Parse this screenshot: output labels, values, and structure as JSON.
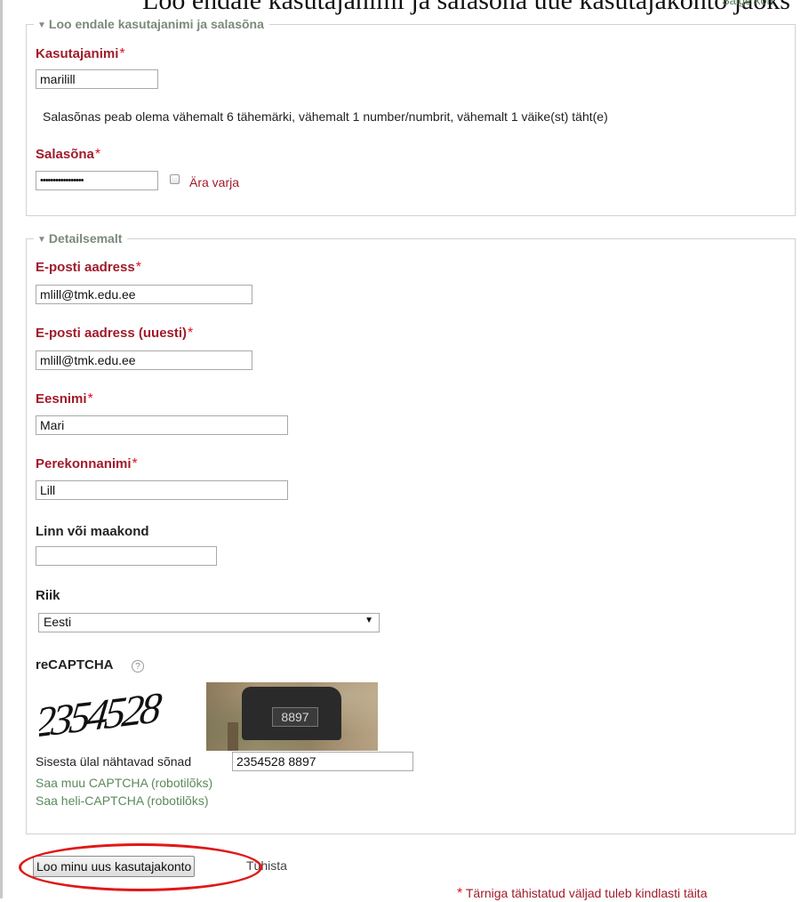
{
  "header": {
    "clipped_title": "Loo endale kasutajanimi ja salasõna uue kasutajakonto jaoks",
    "clipped_link": "Salge kon"
  },
  "login_section": {
    "legend": "Loo endale kasutajanimi ja salasõna",
    "username_label": "Kasutajanimi",
    "username_value": "marilill",
    "password_hint": "Salasõnas peab olema vähemalt 6 tähemärki, vähemalt 1 number/numbrit, vähemalt 1 väike(st) täht(e)",
    "password_label": "Salasõna",
    "password_value": "•••••••••••••••••",
    "unmask_label": "Ära varja"
  },
  "details_section": {
    "legend": "Detailsemalt",
    "email_label": "E-posti aadress",
    "email_value": "mlill@tmk.edu.ee",
    "email2_label": "E-posti aadress (uuesti)",
    "email2_value": "mlill@tmk.edu.ee",
    "firstname_label": "Eesnimi",
    "firstname_value": "Mari",
    "lastname_label": "Perekonnanimi",
    "lastname_value": "Lill",
    "city_label": "Linn või maakond",
    "city_value": "",
    "country_label": "Riik",
    "country_value": "Eesti",
    "captcha_label": "reCAPTCHA",
    "captcha_help_icon": "?",
    "captcha_word": "2354528",
    "captcha_photo_number": "8897",
    "captcha_input_label": "Sisesta ülal nähtavad sõnad",
    "captcha_input_value": "2354528 8897",
    "captcha_other": "Saa muu CAPTCHA (robotilõks)",
    "captcha_audio": "Saa heli-CAPTCHA (robotilõks)"
  },
  "actions": {
    "submit_label": "Loo minu uus kasutajakonto",
    "cancel_label": "Tühista",
    "required_note": "Tärniga tähistatud väljad tuleb kindlasti täita"
  },
  "required_mark": "*",
  "colors": {
    "required_label": "#a11b2a",
    "required_star": "#e0101d",
    "link_green": "#5b8a5b",
    "annotation_red": "#e01818"
  }
}
